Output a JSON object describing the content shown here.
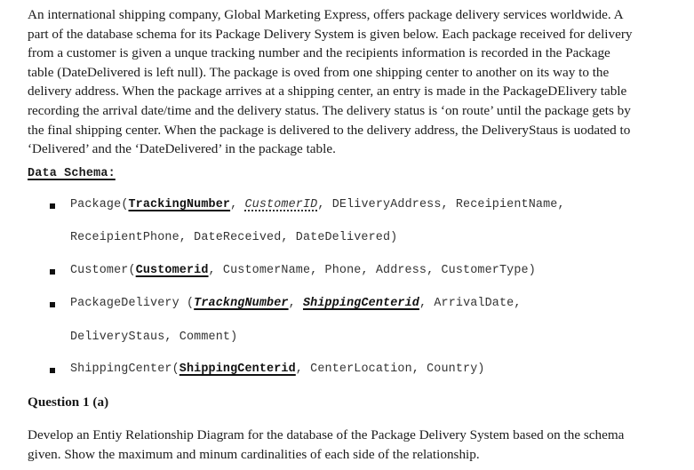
{
  "intro": {
    "lines": [
      "An international shipping company, Global Marketing Express, offers package delivery services worldwide. A",
      "part of the database schema for its Package Delivery System is given below. Each package received for delivery",
      "from a customer is given a unque tracking number and the recipients information is recorded in the Package",
      "table (DateDelivered is left null). The package is oved from one shipping center to another on its way to the",
      "delivery address. When the package arrives at a shipping center, an entry is made in the PackageDElivery table",
      "recording the arrival date/time and the delivery status. The delivery status is ‘on route’ until the package gets by",
      "the final shipping center. When the package is delivered to the delivery address, the DeliveryStaus is uodated to",
      "‘Delivered’ and the ‘DateDelivered’ in the package table."
    ]
  },
  "schema": {
    "heading": "Data Schema:",
    "package": {
      "name": "Package",
      "open": "(",
      "pk": "TrackingNumber",
      "sep1": ", ",
      "fk": "CustomerID",
      "rest1": ", DEliveryAddress, ReceipientName,",
      "rest2": "ReceipientPhone, DateReceived, DateDelivered)"
    },
    "customer": {
      "name": "Customer",
      "open": "(",
      "pk": "Customerid",
      "rest": ", CustomerName, Phone, Address, CustomerType)"
    },
    "package_delivery": {
      "name": "PackageDelivery",
      "open": " (",
      "pk1": "TrackngNumber",
      "sep": ", ",
      "pk2": "ShippingCenterid",
      "rest1": ", ArrivalDate,",
      "rest2": "DeliveryStaus, Comment)"
    },
    "shipping_center": {
      "name": "ShippingCenter",
      "open": "(",
      "pk": "ShippingCenterid",
      "rest": ", CenterLocation, Country)"
    }
  },
  "question": {
    "heading": "Question 1 (a)",
    "lines": [
      "Develop an Entiy Relationship Diagram for the database of the Package Delivery System based on the schema",
      "given. Show the maximum and minum cardinalities of each side of the relationship."
    ]
  }
}
